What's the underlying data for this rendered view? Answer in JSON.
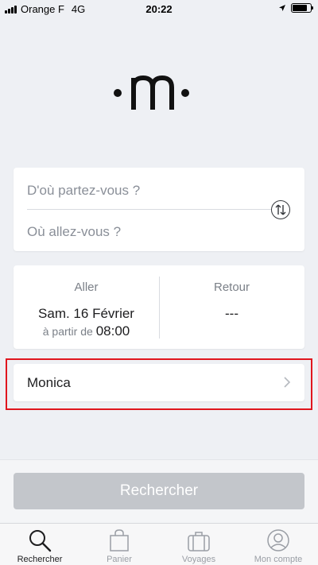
{
  "status_bar": {
    "carrier": "Orange F",
    "network": "4G",
    "time": "20:22",
    "battery_level": 0.8
  },
  "logo": {
    "icon": "mlogo-icon"
  },
  "route": {
    "from_placeholder": "D'où partez-vous ?",
    "to_placeholder": "Où allez-vous ?",
    "swap_icon": "swap-arrows-icon"
  },
  "dates": {
    "outbound": {
      "heading": "Aller",
      "date": "Sam. 16 Février",
      "from_prefix": "à partir de",
      "time": "08:00"
    },
    "return": {
      "heading": "Retour",
      "value": "---"
    }
  },
  "passenger": {
    "name": "Monica",
    "icon": "chevron-right-icon"
  },
  "search": {
    "label": "Rechercher"
  },
  "tab_bar": {
    "tabs": [
      {
        "label": "Rechercher",
        "icon": "search-icon",
        "active": true
      },
      {
        "label": "Panier",
        "icon": "bag-icon",
        "active": false
      },
      {
        "label": "Voyages",
        "icon": "suitcase-icon",
        "active": false
      },
      {
        "label": "Mon compte",
        "icon": "user-icon",
        "active": false
      }
    ]
  },
  "colors": {
    "background": "#eef0f4",
    "card": "#ffffff",
    "highlight": "#e0161e",
    "button_disabled": "#c3c6cb",
    "muted_text": "#8a8f98"
  }
}
